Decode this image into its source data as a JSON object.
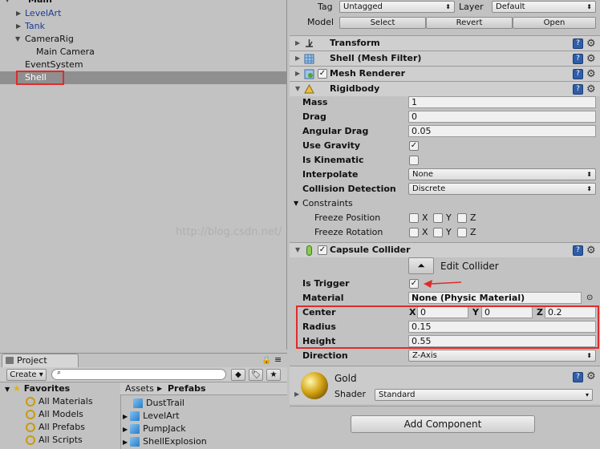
{
  "hierarchy": {
    "scene_name": "Main",
    "items": [
      {
        "label": "LevelArt"
      },
      {
        "label": "Tank"
      },
      {
        "label": "CameraRig"
      },
      {
        "label": "Main Camera"
      },
      {
        "label": "EventSystem"
      },
      {
        "label": "Shell"
      }
    ]
  },
  "project": {
    "tab_label": "Project",
    "create_label": "Create",
    "favorites_label": "Favorites",
    "favorites": [
      "All Materials",
      "All Models",
      "All Prefabs",
      "All Scripts"
    ],
    "breadcrumb": [
      "Assets",
      "Prefabs"
    ],
    "assets": [
      "DustTrail",
      "LevelArt",
      "PumpJack",
      "ShellExplosion"
    ]
  },
  "inspector": {
    "tag_label": "Tag",
    "tag_value": "Untagged",
    "layer_label": "Layer",
    "layer_value": "Default",
    "model_label": "Model",
    "model_buttons": [
      "Select",
      "Revert",
      "Open"
    ],
    "components": {
      "transform": "Transform",
      "mesh_filter": "Shell (Mesh Filter)",
      "mesh_renderer": "Mesh Renderer",
      "rigidbody": "Rigidbody",
      "capsule_collider": "Capsule Collider"
    },
    "rigidbody": {
      "mass_label": "Mass",
      "mass": "1",
      "drag_label": "Drag",
      "drag": "0",
      "angular_drag_label": "Angular Drag",
      "angular_drag": "0.05",
      "use_gravity_label": "Use Gravity",
      "use_gravity": true,
      "is_kinematic_label": "Is Kinematic",
      "is_kinematic": false,
      "interpolate_label": "Interpolate",
      "interpolate": "None",
      "collision_label": "Collision Detection",
      "collision": "Discrete",
      "constraints_label": "Constraints",
      "freeze_position_label": "Freeze Position",
      "freeze_rotation_label": "Freeze Rotation",
      "axis_x": "X",
      "axis_y": "Y",
      "axis_z": "Z"
    },
    "capsule": {
      "edit_collider_label": "Edit Collider",
      "is_trigger_label": "Is Trigger",
      "is_trigger": true,
      "material_label": "Material",
      "material": "None (Physic Material)",
      "center_label": "Center",
      "center_x_label": "X",
      "center_x": "0",
      "center_y_label": "Y",
      "center_y": "0",
      "center_z_label": "Z",
      "center_z": "0.2",
      "radius_label": "Radius",
      "radius": "0.15",
      "height_label": "Height",
      "height": "0.55",
      "direction_label": "Direction",
      "direction": "Z-Axis"
    },
    "material": {
      "name": "Gold",
      "shader_label": "Shader",
      "shader": "Standard"
    },
    "add_component_label": "Add Component"
  },
  "watermark": "http://blog.csdn.net/",
  "colors": {
    "highlight_red": "#e02b2b",
    "selection": "#8f8f8f",
    "link_blue": "#1b3b9a"
  }
}
